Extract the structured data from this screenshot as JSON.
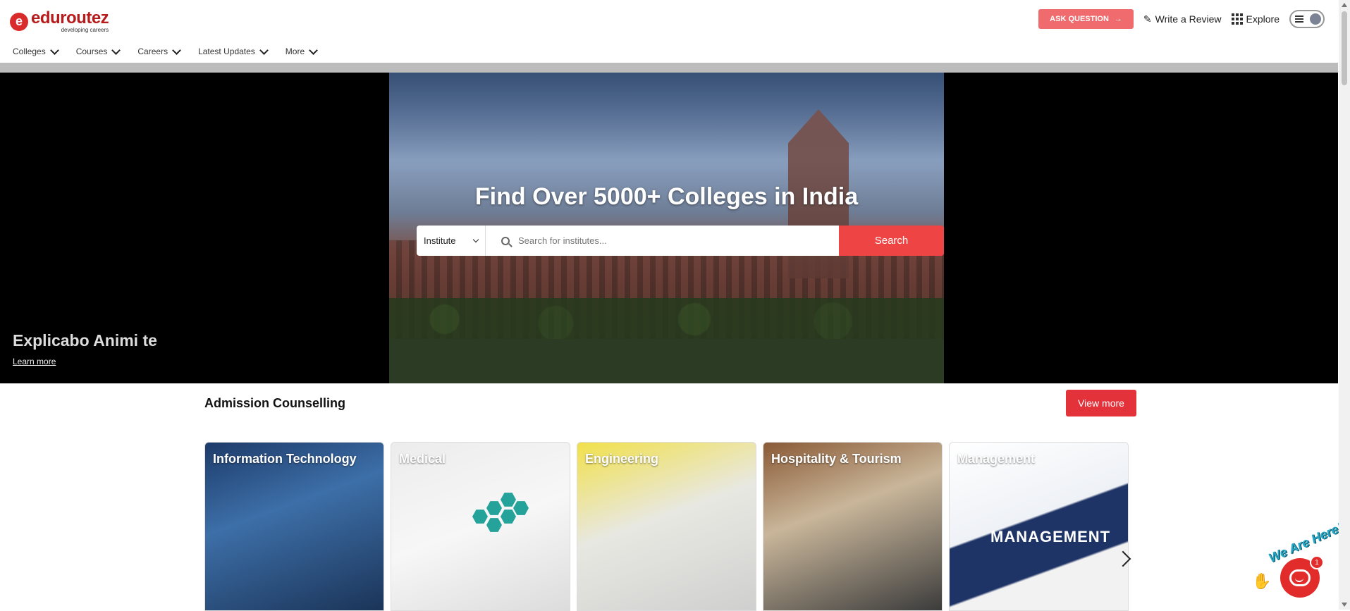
{
  "brand": {
    "name": "eduroutez",
    "tagline": "developing careers",
    "logo_icon": "e-logo-icon",
    "accent": "#ef4444"
  },
  "nav": {
    "items": [
      {
        "label": "Colleges"
      },
      {
        "label": "Courses"
      },
      {
        "label": "Careers"
      },
      {
        "label": "Latest Updates"
      },
      {
        "label": "More"
      }
    ]
  },
  "header": {
    "ask_question": "ASK QUESTION",
    "write_review": "Write a Review",
    "explore": "Explore"
  },
  "hero": {
    "title": "Find Over 5000+ Colleges in India",
    "search_type": "Institute",
    "search_placeholder": "Search for institutes...",
    "search_button": "Search",
    "slide_caption": "Explicabo Animi te",
    "learn_more": "Learn more"
  },
  "counselling": {
    "title": "Admission Counselling",
    "view_more": "View more",
    "cards": [
      {
        "label": "Information Technology"
      },
      {
        "label": "Medical"
      },
      {
        "label": "Engineering"
      },
      {
        "label": "Hospitality & Tourism"
      },
      {
        "label": "Management"
      }
    ],
    "management_banner": "MANAGEMENT"
  },
  "chat": {
    "label": "We Are Here!",
    "badge": "1"
  }
}
